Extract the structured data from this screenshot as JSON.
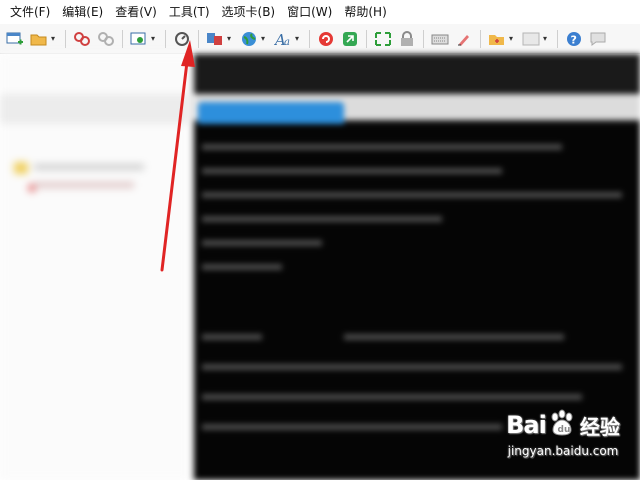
{
  "menu": {
    "items": [
      {
        "label": "文件(F)"
      },
      {
        "label": "编辑(E)"
      },
      {
        "label": "查看(V)"
      },
      {
        "label": "工具(T)"
      },
      {
        "label": "选项卡(B)"
      },
      {
        "label": "窗口(W)"
      },
      {
        "label": "帮助(H)"
      }
    ]
  },
  "toolbar": {
    "icons": [
      "new-session-icon",
      "open-folder-icon",
      "connect-icon",
      "disconnect-icon",
      "session-settings-icon",
      "reconnect-icon",
      "transfer-icon",
      "globe-icon",
      "font-icon",
      "script-icon",
      "xftp-icon",
      "fullscreen-icon",
      "lock-icon",
      "keyboard-icon",
      "highlight-icon",
      "new-tab-icon",
      "layout-icon",
      "help-icon",
      "chat-icon"
    ]
  },
  "annotation": {
    "arrow_color": "#e02424"
  },
  "watermark": {
    "brand_left": "Bai",
    "brand_right": "经验",
    "url": "jingyan.baidu.com"
  },
  "colors": {
    "accent_tab": "#2d8fdc",
    "terminal_bg": "#050505"
  }
}
